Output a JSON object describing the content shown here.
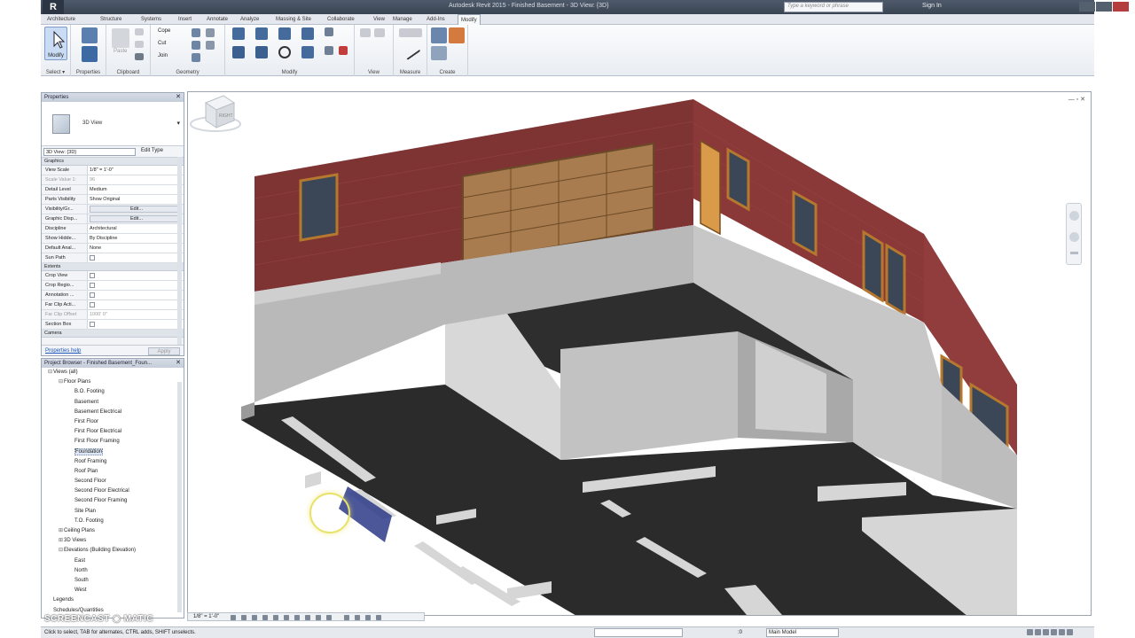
{
  "app": {
    "title": "Autodesk Revit 2015 - Finished Basement - 3D View: {3D}",
    "logo": "R",
    "search_placeholder": "Type a keyword or phrase",
    "sign_in": "Sign In"
  },
  "ribbon": {
    "tabs": [
      "Architecture",
      "Structure",
      "Systems",
      "Insert",
      "Annotate",
      "Analyze",
      "Massing & Site",
      "Collaborate",
      "View",
      "Manage",
      "Add-Ins",
      "Modify"
    ],
    "active_tab": "Modify",
    "groups": {
      "select": "Select ▾",
      "properties": "Properties",
      "clipboard": "Clipboard",
      "geometry": "Geometry",
      "modify": "Modify",
      "view": "View",
      "measure": "Measure",
      "create": "Create"
    },
    "buttons": {
      "modify": "Modify",
      "paste": "Paste",
      "cope": "Cope",
      "cut": "Cut",
      "join": "Join"
    }
  },
  "properties": {
    "header": "Properties",
    "type_name": "3D View",
    "instance_selector": "3D View: {3D}",
    "edit_type": "Edit Type",
    "sections": {
      "graphics": "Graphics",
      "extents": "Extents",
      "camera": "Camera"
    },
    "graphics_rows": [
      {
        "key": "View Scale",
        "value": "1/8\" = 1'-0\""
      },
      {
        "key": "Scale Value 1:",
        "value": "96"
      },
      {
        "key": "Detail Level",
        "value": "Medium"
      },
      {
        "key": "Parts Visibility",
        "value": "Show Original"
      },
      {
        "key": "Visibility/Gr...",
        "value": "Edit..."
      },
      {
        "key": "Graphic Disp...",
        "value": "Edit..."
      },
      {
        "key": "Discipline",
        "value": "Architectural"
      },
      {
        "key": "Show Hidde...",
        "value": "By Discipline"
      },
      {
        "key": "Default Anal...",
        "value": "None"
      },
      {
        "key": "Sun Path",
        "value": ""
      }
    ],
    "extents_rows": [
      {
        "key": "Crop View",
        "value": ""
      },
      {
        "key": "Crop Regio...",
        "value": ""
      },
      {
        "key": "Annotation ...",
        "value": ""
      },
      {
        "key": "Far Clip Acti...",
        "value": ""
      },
      {
        "key": "Far Clip Offset",
        "value": "1000' 0\""
      },
      {
        "key": "Section Box",
        "value": ""
      }
    ],
    "help_link": "Properties help",
    "apply": "Apply"
  },
  "browser": {
    "header": "Project Browser - Finished Basement_Foun...",
    "items": [
      {
        "label": "Views (all)",
        "level": 0,
        "exp": "⊟"
      },
      {
        "label": "Floor Plans",
        "level": 1,
        "exp": "⊟"
      },
      {
        "label": "B.O. Footing",
        "level": 2,
        "exp": ""
      },
      {
        "label": "Basement",
        "level": 2,
        "exp": ""
      },
      {
        "label": "Basement Electrical",
        "level": 2,
        "exp": ""
      },
      {
        "label": "First Floor",
        "level": 2,
        "exp": ""
      },
      {
        "label": "First Floor Electrical",
        "level": 2,
        "exp": ""
      },
      {
        "label": "First Floor Framing",
        "level": 2,
        "exp": ""
      },
      {
        "label": "Foundation",
        "level": 2,
        "exp": "",
        "selected": true
      },
      {
        "label": "Roof Framing",
        "level": 2,
        "exp": ""
      },
      {
        "label": "Roof Plan",
        "level": 2,
        "exp": ""
      },
      {
        "label": "Second Floor",
        "level": 2,
        "exp": ""
      },
      {
        "label": "Second Floor Electrical",
        "level": 2,
        "exp": ""
      },
      {
        "label": "Second Floor Framing",
        "level": 2,
        "exp": ""
      },
      {
        "label": "Site Plan",
        "level": 2,
        "exp": ""
      },
      {
        "label": "T.O. Footing",
        "level": 2,
        "exp": ""
      },
      {
        "label": "Ceiling Plans",
        "level": 1,
        "exp": "⊞"
      },
      {
        "label": "3D Views",
        "level": 1,
        "exp": "⊞"
      },
      {
        "label": "Elevations (Building Elevation)",
        "level": 1,
        "exp": "⊟"
      },
      {
        "label": "East",
        "level": 2,
        "exp": ""
      },
      {
        "label": "North",
        "level": 2,
        "exp": ""
      },
      {
        "label": "South",
        "level": 2,
        "exp": ""
      },
      {
        "label": "West",
        "level": 2,
        "exp": ""
      },
      {
        "label": "Legends",
        "level": 0,
        "exp": ""
      },
      {
        "label": "Schedules/Quantities",
        "level": 0,
        "exp": ""
      }
    ]
  },
  "viewcube": {
    "face": "RIGHT"
  },
  "view_control": {
    "scale": "1/8\" = 1'-0\""
  },
  "status": {
    "message": "Click to select, TAB for alternates, CTRL adds, SHIFT unselects.",
    "workset": ":0",
    "model": "Main Model"
  },
  "watermark": "SCREENCAST ◉ MATIC",
  "colors": {
    "brick": "#8a3838",
    "concrete": "#b9b9b9",
    "slab": "#2b2b2b",
    "window_frame": "#b6782e",
    "garage_door": "#a87c4e"
  }
}
